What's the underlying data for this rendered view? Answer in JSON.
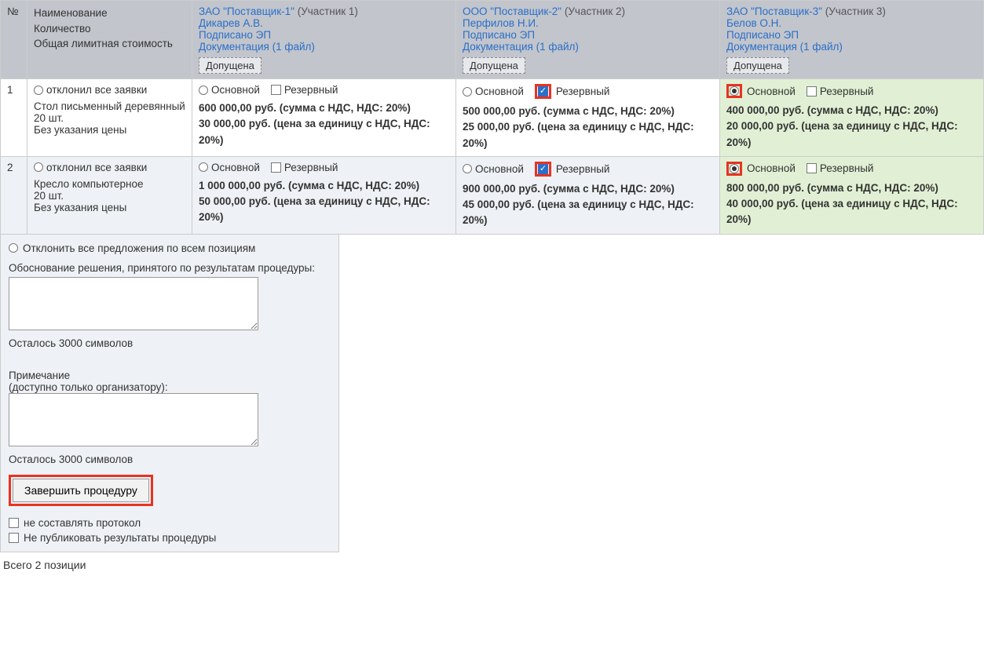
{
  "header": {
    "num": "№",
    "name_lines": [
      "Наименование",
      "Количество",
      "Общая лимитная стоимость"
    ],
    "suppliers": [
      {
        "company": "ЗАО \"Поставщик-1\"",
        "participant": "(Участник 1)",
        "person": "Дикарев А.В.",
        "signed": "Подписано ЭП",
        "docs": "Документация (1 файл)",
        "status": "Допущена"
      },
      {
        "company": "ООО \"Поставщик-2\"",
        "participant": "(Участник 2)",
        "person": "Перфилов Н.И.",
        "signed": "Подписано ЭП",
        "docs": "Документация (1 файл)",
        "status": "Допущена"
      },
      {
        "company": "ЗАО \"Поставщик-3\"",
        "participant": "(Участник 3)",
        "person": "Белов О.Н.",
        "signed": "Подписано ЭП",
        "docs": "Документация (1 файл)",
        "status": "Допущена"
      }
    ]
  },
  "labels": {
    "reject_all": "отклонил все заявки",
    "main": "Основной",
    "reserve": "Резервный"
  },
  "rows": [
    {
      "num": "1",
      "item_lines": [
        "Стол письменный деревянный",
        "20 шт.",
        "Без указания цены"
      ],
      "offers": [
        {
          "highlight": false,
          "main_checked": false,
          "reserve_checked": false,
          "reserve_red": false,
          "main_red": false,
          "sum": "600 000,00 руб. (сумма с НДС, НДС: 20%)",
          "unit": "30 000,00 руб. (цена за единицу с НДС, НДС: 20%)"
        },
        {
          "highlight": false,
          "main_checked": false,
          "reserve_checked": true,
          "reserve_red": true,
          "main_red": false,
          "sum": "500 000,00 руб. (сумма с НДС, НДС: 20%)",
          "unit": "25 000,00 руб. (цена за единицу с НДС, НДС: 20%)"
        },
        {
          "highlight": true,
          "main_checked": true,
          "reserve_checked": false,
          "reserve_red": false,
          "main_red": true,
          "sum": "400 000,00 руб. (сумма с НДС, НДС: 20%)",
          "unit": "20 000,00 руб. (цена за единицу с НДС, НДС: 20%)"
        }
      ]
    },
    {
      "num": "2",
      "item_lines": [
        "Кресло компьютерное",
        "20 шт.",
        "Без указания цены"
      ],
      "offers": [
        {
          "highlight": false,
          "main_checked": false,
          "reserve_checked": false,
          "reserve_red": false,
          "main_red": false,
          "sum": "1 000 000,00 руб. (сумма с НДС, НДС: 20%)",
          "unit": "50 000,00 руб. (цена за единицу с НДС, НДС: 20%)"
        },
        {
          "highlight": false,
          "main_checked": false,
          "reserve_checked": true,
          "reserve_red": true,
          "main_red": false,
          "sum": "900 000,00 руб. (сумма с НДС, НДС: 20%)",
          "unit": "45 000,00 руб. (цена за единицу с НДС, НДС: 20%)"
        },
        {
          "highlight": true,
          "main_checked": true,
          "reserve_checked": false,
          "reserve_red": false,
          "main_red": true,
          "sum": "800 000,00 руб. (сумма с НДС, НДС: 20%)",
          "unit": "40 000,00 руб. (цена за единицу с НДС, НДС: 20%)"
        }
      ]
    }
  ],
  "bottom": {
    "reject_all_positions": "Отклонить все предложения по всем позициям",
    "decision_label": "Обоснование решения, принятого по результатам процедуры:",
    "chars_left_1": "Осталось 3000 символов",
    "note_label_1": "Примечание",
    "note_label_2": "(доступно только организатору):",
    "chars_left_2": "Осталось 3000 символов",
    "finish_btn": "Завершить процедуру",
    "no_protocol": "не составлять протокол",
    "no_publish": "Не публиковать результаты процедуры"
  },
  "total": "Всего 2 позиции"
}
